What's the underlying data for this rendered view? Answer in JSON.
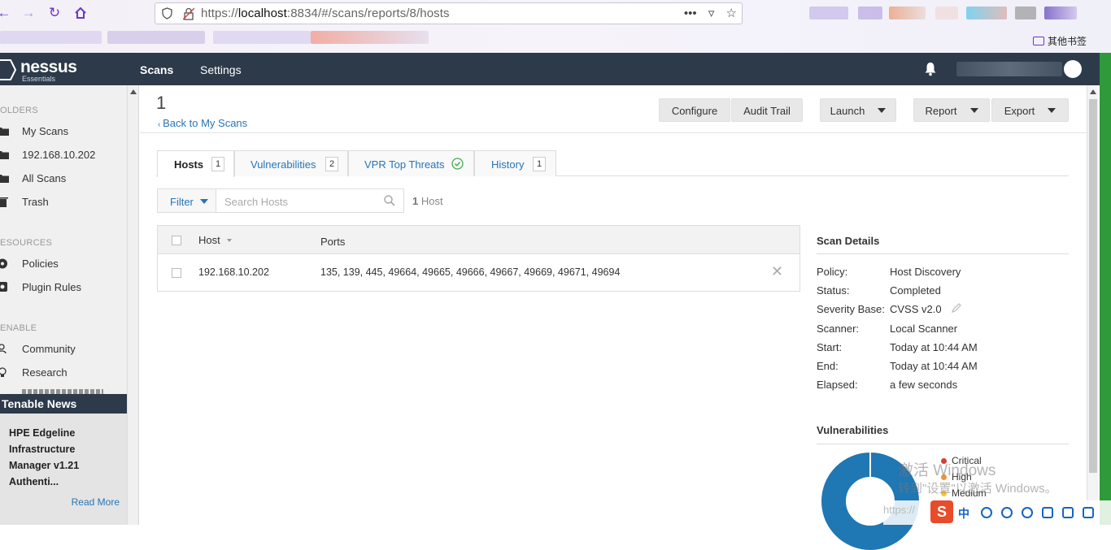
{
  "browser": {
    "url_prefix": "https://",
    "url_host": "localhost",
    "url_rest": ":8834/#/scans/reports/8/hosts",
    "actions": "•••",
    "other_bookmarks": "其他书签"
  },
  "app": {
    "logo_name": "nessus",
    "logo_sub": "Essentials",
    "nav": [
      "Scans",
      "Settings"
    ]
  },
  "sidebar": {
    "folders_head": "OLDERS",
    "folders": [
      "My Scans",
      "192.168.10.202",
      "All Scans",
      "Trash"
    ],
    "resources_head": "ESOURCES",
    "resources": [
      "Policies",
      "Plugin Rules"
    ],
    "tenable_head": "ENABLE",
    "tenable": [
      "Community",
      "Research"
    ],
    "news_title": "Tenable News",
    "news_body": "HPE Edgeline Infrastructure Manager v1.21 Authenti...",
    "read_more": "Read More"
  },
  "main": {
    "scan_title": "1",
    "back_link": "Back to My Scans",
    "buttons": {
      "configure": "Configure",
      "audit": "Audit Trail",
      "launch": "Launch",
      "report": "Report",
      "export": "Export"
    },
    "tabs": [
      {
        "label": "Hosts",
        "count": "1"
      },
      {
        "label": "Vulnerabilities",
        "count": "2"
      },
      {
        "label": "VPR Top Threats"
      },
      {
        "label": "History",
        "count": "1"
      }
    ],
    "filter_label": "Filter",
    "search_placeholder": "Search Hosts",
    "host_count_num": "1",
    "host_count_label": "Host",
    "table": {
      "col_host": "Host",
      "col_ports": "Ports",
      "rows": [
        {
          "host": "192.168.10.202",
          "ports": "135, 139, 445, 49664, 49665, 49666, 49667, 49669, 49671, 49694"
        }
      ]
    }
  },
  "details": {
    "title": "Scan Details",
    "items": [
      {
        "k": "Policy:",
        "v": "Host Discovery"
      },
      {
        "k": "Status:",
        "v": "Completed"
      },
      {
        "k": "Severity Base:",
        "v": "CVSS v2.0"
      },
      {
        "k": "Scanner:",
        "v": "Local Scanner"
      },
      {
        "k": "Start:",
        "v": "Today at 10:44 AM"
      },
      {
        "k": "End:",
        "v": "Today at 10:44 AM"
      },
      {
        "k": "Elapsed:",
        "v": "a few seconds"
      }
    ],
    "vulns_title": "Vulnerabilities",
    "legend": [
      {
        "label": "Critical",
        "color": "#d43f3a"
      },
      {
        "label": "High",
        "color": "#ee9336"
      },
      {
        "label": "Medium",
        "color": "#fdc431"
      }
    ]
  },
  "overlay": {
    "watermark1": "激活 Windows",
    "watermark2": "转到\"设置\"以激活 Windows。",
    "url_fragment": "https://",
    "ime_s": "S",
    "ime_zh": "中"
  }
}
